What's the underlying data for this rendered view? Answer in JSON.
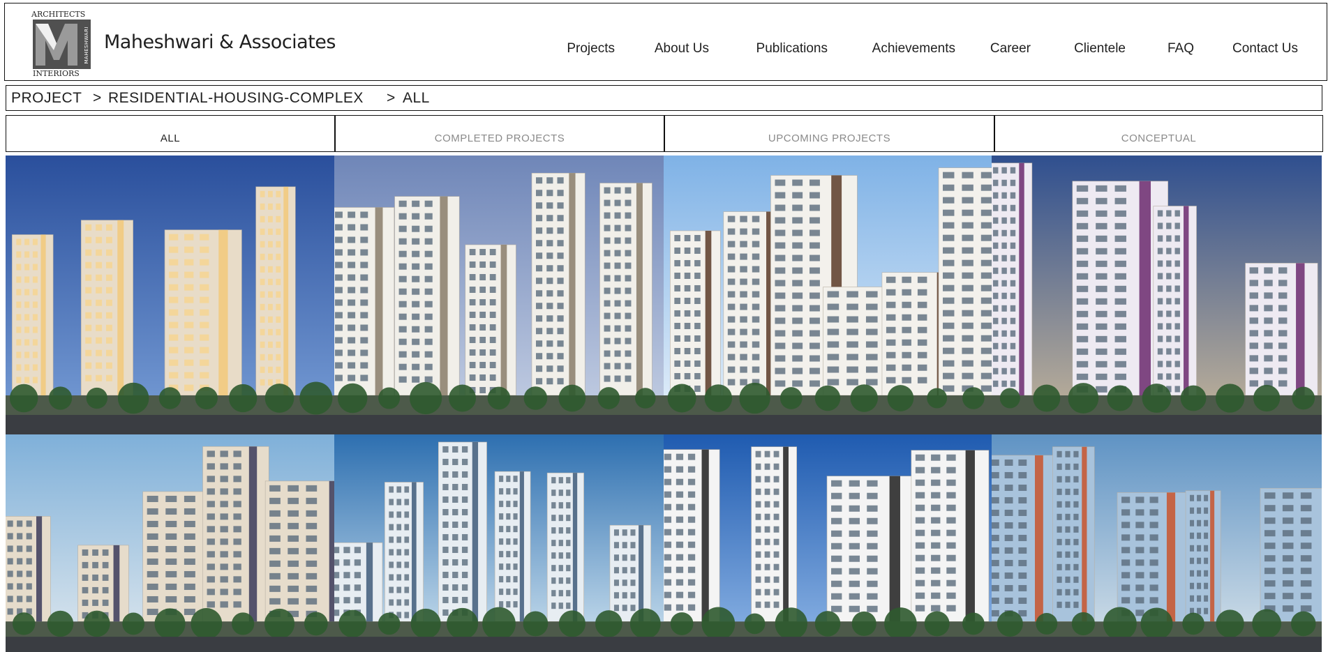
{
  "header": {
    "logo": {
      "top_text": "ARCHITECTS",
      "bottom_text": "INTERIORS",
      "vertical_text": "MAHESHWARI"
    },
    "brand_name": "Maheshwari & Associates",
    "nav": [
      {
        "label": "Projects"
      },
      {
        "label": "About Us"
      },
      {
        "label": "Publications"
      },
      {
        "label": "Achievements"
      },
      {
        "label": "Career"
      },
      {
        "label": "Clientele"
      },
      {
        "label": "FAQ"
      },
      {
        "label": "Contact Us"
      }
    ]
  },
  "breadcrumb": {
    "items": [
      "PROJECT",
      ">",
      "RESIDENTIAL-HOUSING-COMPLEX",
      ">",
      "ALL"
    ]
  },
  "tabs": [
    {
      "label": "ALL",
      "active": true
    },
    {
      "label": "COMPLETED PROJECTS",
      "active": false
    },
    {
      "label": "UPCOMING PROJECTS",
      "active": false
    },
    {
      "label": "CONCEPTUAL",
      "active": false
    }
  ],
  "gallery": {
    "items": [
      {
        "name": "night-courtyard-towers",
        "sky": "#2a4f9c",
        "sky2": "#7aa0d8",
        "building": "#e8dcc8",
        "accent": "#f2c97a"
      },
      {
        "name": "white-towers-street",
        "sky": "#6f86b8",
        "sky2": "#c9d3e6",
        "building": "#f1efe9",
        "accent": "#8a7d6a"
      },
      {
        "name": "brown-white-highway",
        "sky": "#7fb2e6",
        "sky2": "#eaf3fb",
        "building": "#f3f1ec",
        "accent": "#5a3b28"
      },
      {
        "name": "purple-accent-towers",
        "sky": "#2f4f8f",
        "sky2": "#c9b89a",
        "building": "#eeeaf2",
        "accent": "#6b2a6e"
      },
      {
        "name": "beige-frame-complex",
        "sky": "#7fb0d9",
        "sky2": "#dfe8ee",
        "building": "#e6dccb",
        "accent": "#3a3a5a"
      },
      {
        "name": "blue-grey-blocks",
        "sky": "#2d6fb0",
        "sky2": "#cfe3f0",
        "building": "#e7edf2",
        "accent": "#3e5a7a"
      },
      {
        "name": "tall-black-white-tower",
        "sky": "#1f5bb0",
        "sky2": "#8fb6e6",
        "building": "#f4f4f4",
        "accent": "#1e1e1e"
      },
      {
        "name": "glass-blue-towers",
        "sky": "#5f93c4",
        "sky2": "#d8e3ea",
        "building": "#a8c3dc",
        "accent": "#c9542c"
      }
    ]
  }
}
